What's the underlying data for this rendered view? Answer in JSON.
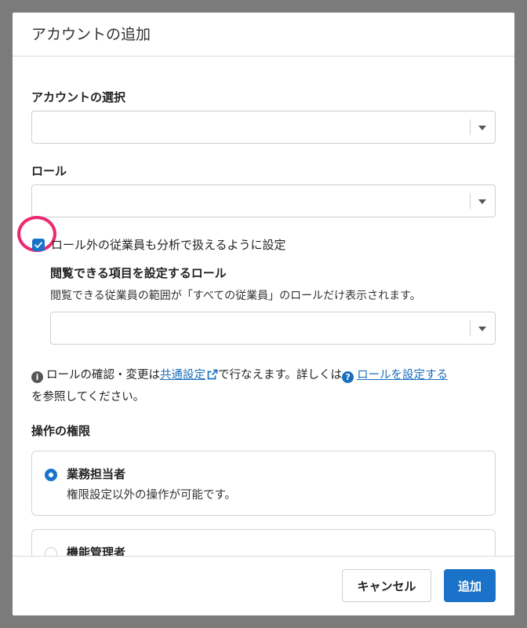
{
  "dialog": {
    "title": "アカウントの追加"
  },
  "account_select": {
    "label": "アカウントの選択",
    "value": ""
  },
  "role_select": {
    "label": "ロール",
    "value": ""
  },
  "outside_role": {
    "checked": true,
    "label": "ロール外の従業員も分析で扱えるように設定",
    "sub_label": "閲覧できる項目を設定するロール",
    "help": "閲覧できる従業員の範囲が「すべての従業員」のロールだけ表示されます。",
    "select_value": ""
  },
  "info": {
    "text_before": "ロールの確認・変更は",
    "link_common": "共通設定",
    "text_middle": "で行なえます。詳しくは",
    "link_role": "ロールを設定する",
    "text_after": "を参照してください。"
  },
  "permissions": {
    "label": "操作の権限",
    "options": [
      {
        "title": "業務担当者",
        "desc": "権限設定以外の操作が可能です。",
        "selected": true
      },
      {
        "title": "機能管理者",
        "desc": "",
        "selected": false
      }
    ]
  },
  "footer": {
    "cancel": "キャンセル",
    "add": "追加"
  },
  "colors": {
    "accent": "#1a73c8",
    "highlight": "#ec2870",
    "link": "#1a6fbd"
  }
}
